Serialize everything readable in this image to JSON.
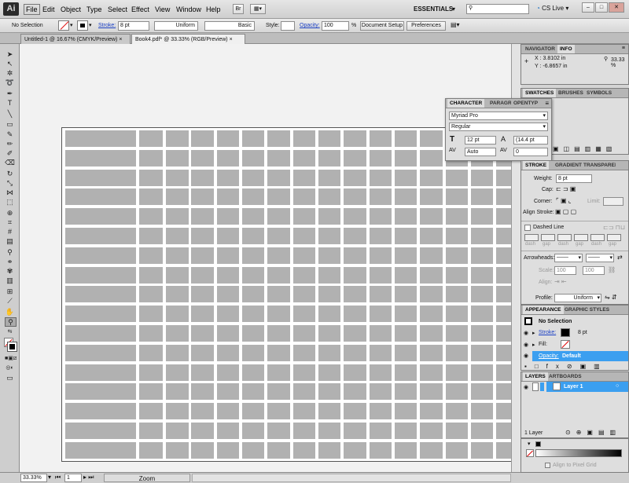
{
  "app": {
    "logo": "Ai"
  },
  "menu": [
    "File",
    "Edit",
    "Object",
    "Type",
    "Select",
    "Effect",
    "View",
    "Window",
    "Help"
  ],
  "workspace": {
    "essentials": "ESSENTIALS",
    "search_placeholder": "",
    "cs_live": "CS Live"
  },
  "control": {
    "selection": "No Selection",
    "stroke_label": "Stroke:",
    "stroke_value": "8 pt",
    "profile_uniform": "Uniform",
    "brush_basic": "Basic",
    "style_label": "Style:",
    "opacity_label": "Opacity:",
    "opacity_value": "100",
    "opacity_unit": "%",
    "doc_setup": "Document Setup",
    "preferences": "Preferences"
  },
  "tabs": [
    "Untitled-1 @ 16.67% (CMYK/Preview)",
    "Book4.pdf* @ 33.33% (RGB/Preview)"
  ],
  "status": {
    "zoom": "33.33%",
    "page": "1",
    "mode": "Zoom"
  },
  "navigator": {
    "tab1": "NAVIGATOR",
    "tab2": "INFO",
    "x": "X : 3.8102 in",
    "y": "Y : -6.8657 in",
    "zoom": "33.33 %"
  },
  "swatches": {
    "tabs": [
      "SWATCHES",
      "BRUSHES",
      "SYMBOLS"
    ]
  },
  "character": {
    "tabs": [
      "CHARACTER",
      "PARAGRAPH",
      "OPENTYPE"
    ],
    "font": "Myriad Pro",
    "style": "Regular",
    "size": "12 pt",
    "leading": "(14.4 pt",
    "kerning": "Auto",
    "tracking": "0"
  },
  "stroke_panel": {
    "tabs": [
      "STROKE",
      "GRADIENT",
      "TRANSPARENCY"
    ],
    "weight_label": "Weight:",
    "weight_value": "8 pt",
    "cap_label": "Cap:",
    "corner_label": "Corner:",
    "limit_label": "Limit:",
    "align_label": "Align Stroke:",
    "dashed_label": "Dashed Line",
    "dash_labels": [
      "dash",
      "gap",
      "dash",
      "gap",
      "dash",
      "gap"
    ],
    "arrowheads_label": "Arrowheads:",
    "scale_label": "Scale:",
    "scale1": "100",
    "scale2": "100",
    "align_arrow_label": "Align:",
    "profile_label": "Profile:",
    "profile_value": "Uniform"
  },
  "appearance": {
    "tabs": [
      "APPEARANCE",
      "GRAPHIC STYLES"
    ],
    "title": "No Selection",
    "stroke_label": "Stroke:",
    "stroke_value": "8 pt",
    "fill_label": "Fill:",
    "opacity_label": "Opacity:",
    "opacity_value": "Default"
  },
  "layers": {
    "tabs": [
      "LAYERS",
      "ARTBOARDS"
    ],
    "layer_name": "Layer 1",
    "count": "1 Layer"
  },
  "gradient_bottom": {
    "align_pixel": "Align to Pixel Grid"
  },
  "colors": {
    "accent": "#3b9ff0",
    "cell": "#b1b1b1"
  }
}
